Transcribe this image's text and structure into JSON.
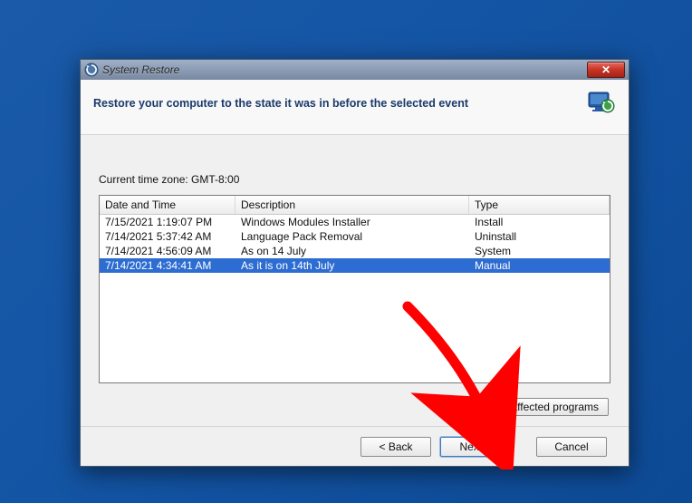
{
  "window": {
    "title": "System Restore",
    "close_label": "✕"
  },
  "header": {
    "heading": "Restore your computer to the state it was in before the selected event"
  },
  "body": {
    "timezone_line": "Current time zone: GMT-8:00",
    "columns": {
      "datetime": "Date and Time",
      "description": "Description",
      "type": "Type"
    },
    "rows": [
      {
        "datetime": "7/15/2021 1:19:07 PM",
        "description": "Windows Modules Installer",
        "type": "Install",
        "selected": false
      },
      {
        "datetime": "7/14/2021 5:37:42 AM",
        "description": "Language Pack Removal",
        "type": "Uninstall",
        "selected": false
      },
      {
        "datetime": "7/14/2021 4:56:09 AM",
        "description": "As on 14 July",
        "type": "System",
        "selected": false
      },
      {
        "datetime": "7/14/2021 4:34:41 AM",
        "description": "As it is on 14th July",
        "type": "Manual",
        "selected": true
      }
    ],
    "scan_button": "Scan for affected programs"
  },
  "footer": {
    "back": "< Back",
    "next": "Next >",
    "cancel": "Cancel"
  },
  "colors": {
    "selection": "#2d6cd0",
    "heading_text": "#1a3a6a",
    "annotation": "#ff0000"
  }
}
